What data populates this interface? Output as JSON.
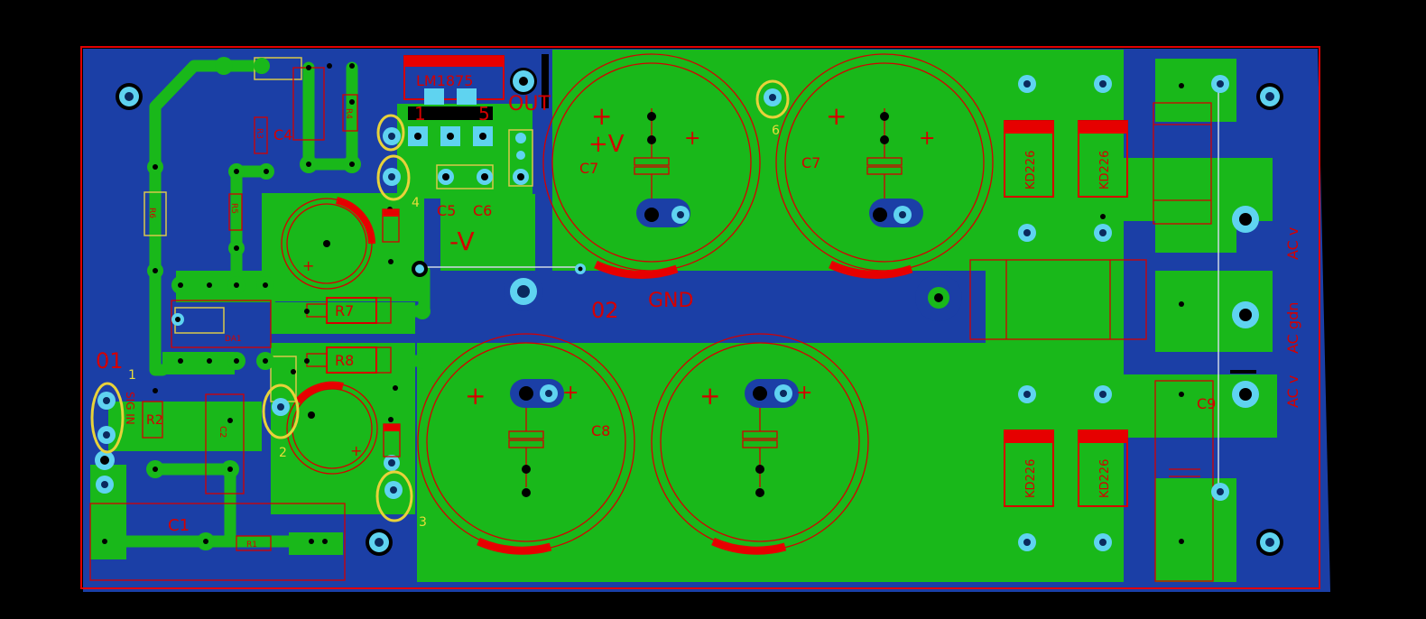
{
  "board": {
    "colors": {
      "background": "#000000",
      "board": "#1b3fa6",
      "copper": "#19b81a",
      "outline": "#e00000",
      "silkscreen": "#d40000",
      "pad": "#5fd3f0",
      "marker": "#e8d23a"
    }
  },
  "labels": {
    "ic": "LM1875",
    "pin1": "1",
    "pin5": "5",
    "out": "OUT",
    "plus_v": "+V",
    "minus_v": "-V",
    "gnd": "GND",
    "o1": "01",
    "o2": "02",
    "sig_in": "SIG IN",
    "ac_v_top": "AC v",
    "ac_gdn": "AC gdn",
    "ac_v_bottom": "AC v"
  },
  "components": {
    "r7": "R7",
    "r8": "R8",
    "r2": "R2",
    "r1": "R1",
    "r3": "R3",
    "r4": "R4",
    "r5": "R5",
    "r6": "R6",
    "c1": "C1",
    "c2": "C2",
    "c4": "C4",
    "c5": "C5",
    "c6": "C6",
    "c7a": "C7",
    "c7b": "C7",
    "c8": "C8",
    "c9": "C9",
    "da1": "DA1",
    "d1": "KD226",
    "d2": "KD226",
    "d3": "KD226",
    "d4": "KD226",
    "plus_sign": "+"
  },
  "markers": {
    "m1": "1",
    "m2": "2",
    "m3": "3",
    "m4": "4",
    "m6": "6"
  }
}
